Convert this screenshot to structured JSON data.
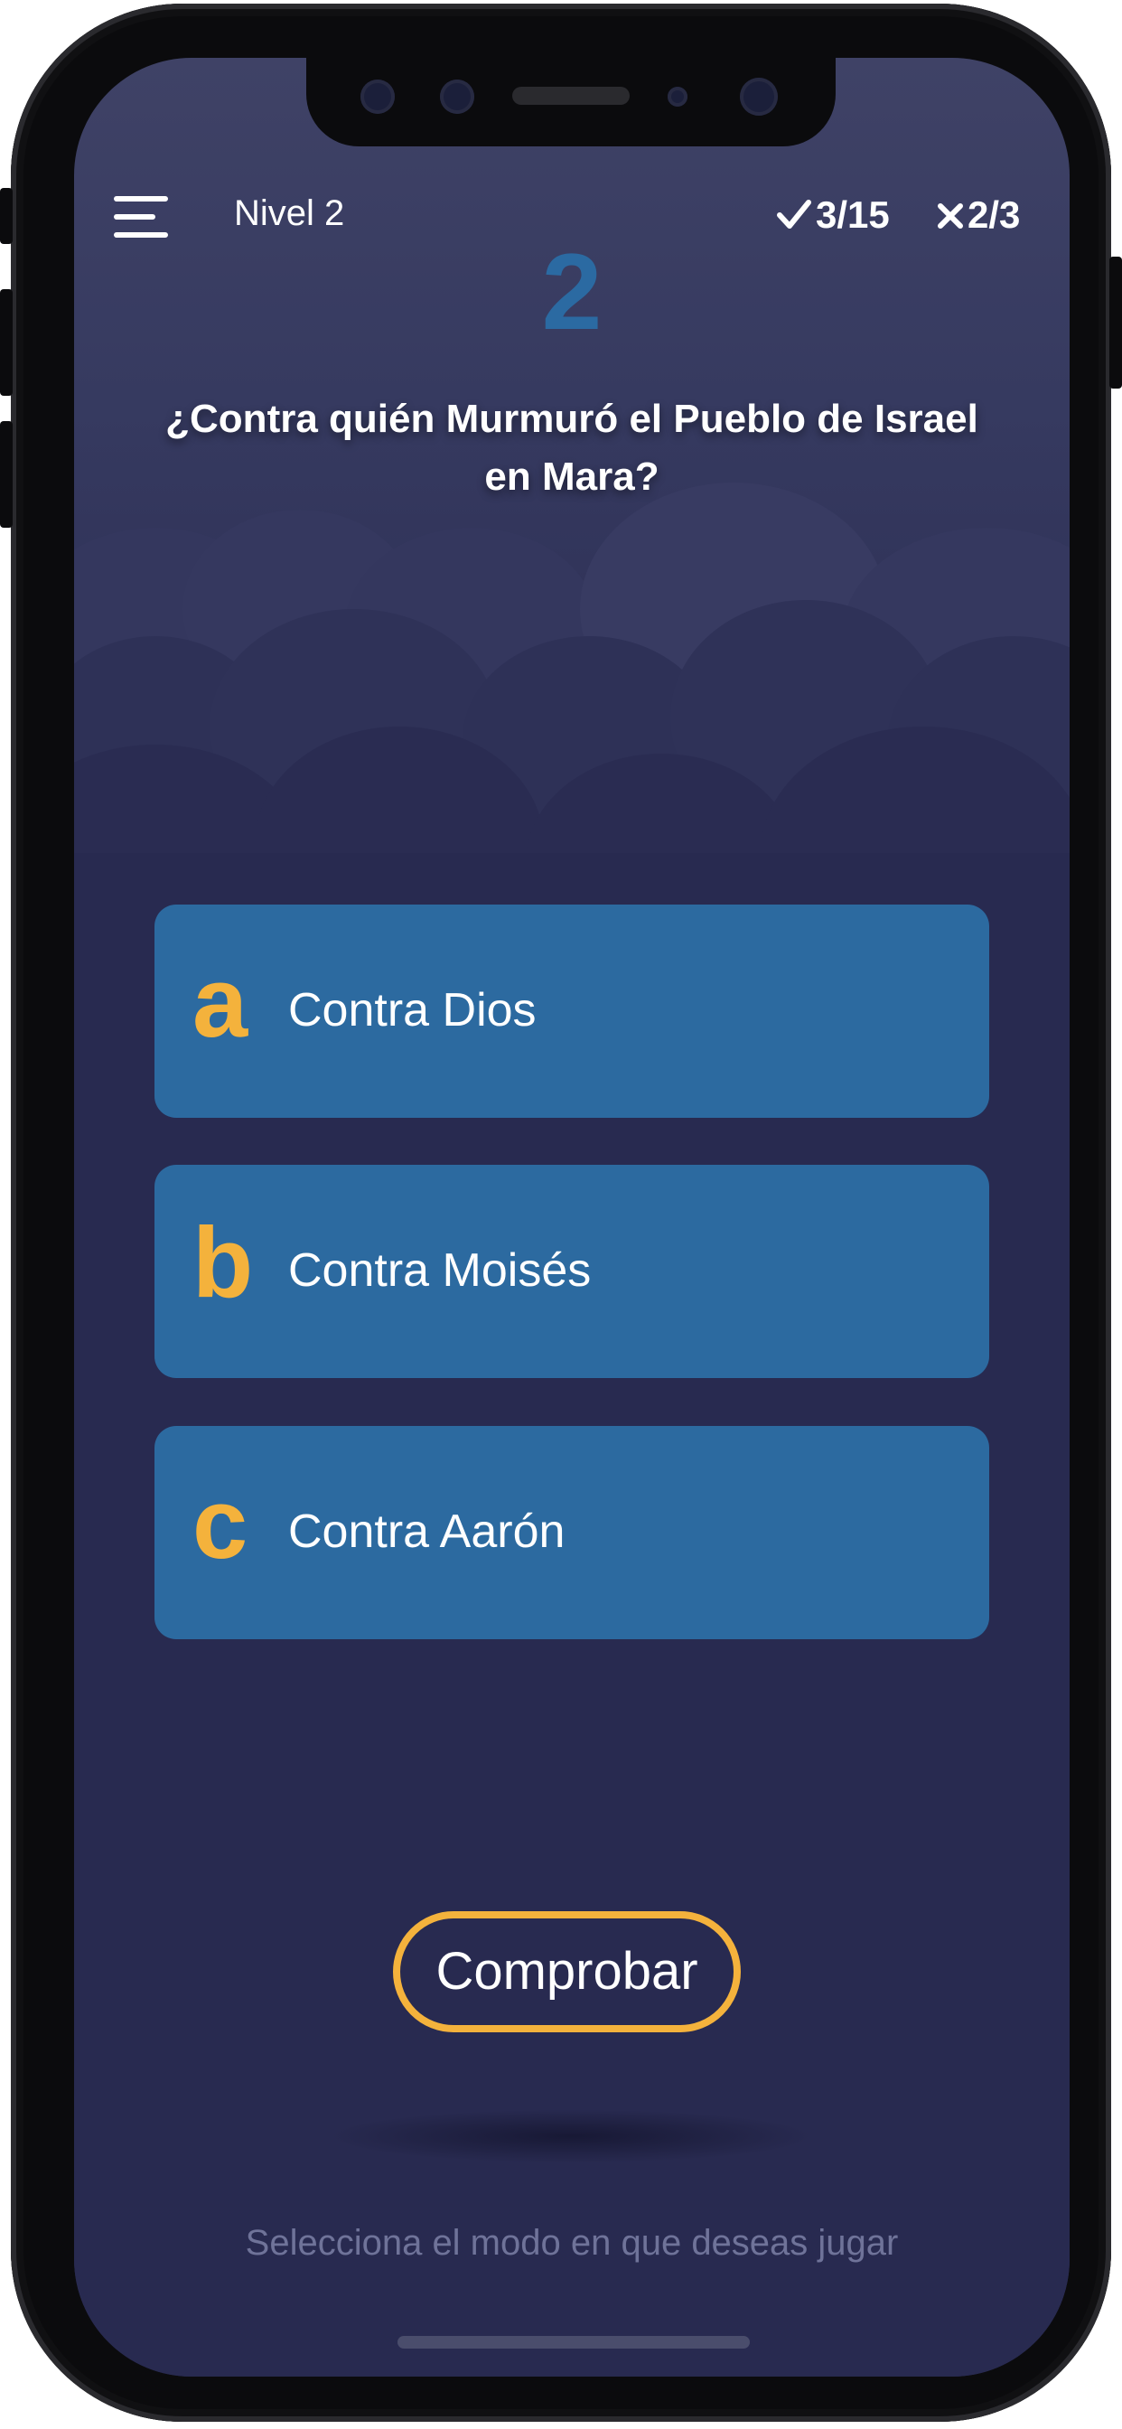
{
  "header": {
    "menu_icon": "hamburger-menu-icon",
    "level_label": "Nivel 2",
    "correct_icon": "checkmark-icon",
    "correct_count": "3/15",
    "wrong_icon": "cross-icon",
    "wrong_count": "2/3"
  },
  "question": {
    "number": "2",
    "text": "¿Contra quién Murmuró el Pueblo de Israel en Mara?"
  },
  "answers": [
    {
      "letter": "a",
      "text": "Contra Dios"
    },
    {
      "letter": "b",
      "text": "Contra Moisés"
    },
    {
      "letter": "c",
      "text": "Contra Aarón"
    }
  ],
  "actions": {
    "check_label": "Comprobar"
  },
  "footer": {
    "hint": "Selecciona el modo en que deseas jugar"
  },
  "colors": {
    "accent": "#f4b23c",
    "answer_bg": "#2c6aa0",
    "question_number": "#2b6aa2",
    "background": "#282a50"
  }
}
